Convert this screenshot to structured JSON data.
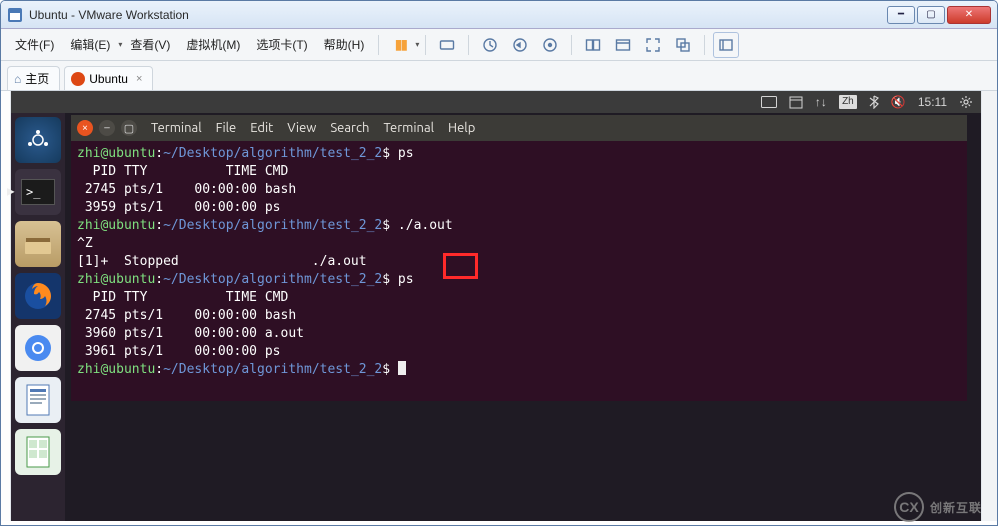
{
  "window": {
    "title": "Ubuntu - VMware Workstation"
  },
  "menubar": {
    "items": [
      {
        "label": "文件(F)"
      },
      {
        "label": "编辑(E)"
      },
      {
        "label": "查看(V)"
      },
      {
        "label": "虚拟机(M)"
      },
      {
        "label": "选项卡(T)"
      },
      {
        "label": "帮助(H)"
      }
    ]
  },
  "tabs": {
    "home": "主页",
    "vm": "Ubuntu"
  },
  "ubuntu_topbar": {
    "lang": "Zh",
    "time": "15:11"
  },
  "term_menu": {
    "items": [
      "Terminal",
      "File",
      "Edit",
      "View",
      "Search",
      "Terminal",
      "Help"
    ]
  },
  "terminal": {
    "prompt_user": "zhi@ubuntu",
    "prompt_path": "~/Desktop/algorithm/test_2_2",
    "dollar": "$",
    "header_pid": "  PID TTY          TIME CMD",
    "line_ps1_cmd": "ps",
    "line_r1": " 2745 pts/1    00:00:00 bash",
    "line_r2": " 3959 pts/1    00:00:00 ps",
    "line_run_cmd": "./a.out",
    "line_ctrlz": "^Z",
    "line_stopped": "[1]+  Stopped                 ./a.out",
    "line_ps2_cmd": "ps",
    "line_s1": " 2745 pts/1    00:00:00 bash",
    "line_s2": " 3960 pts/1    00:00:00 a.out",
    "line_s3": " 3961 pts/1    00:00:00 ps"
  },
  "watermark": {
    "initials": "CX",
    "label": "创新互联"
  }
}
